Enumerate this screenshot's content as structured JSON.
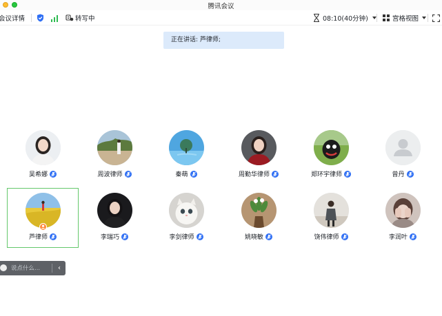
{
  "window": {
    "title": "腾讯会议"
  },
  "toolbar": {
    "meeting_details": "会议详情",
    "transcribe": "转写中",
    "time": "08:10(40分钟)",
    "view": "宫格视图"
  },
  "speaking_banner": "正在讲话: 芦律师;",
  "participants": [
    {
      "name": "吴希娜"
    },
    {
      "name": "周波律师"
    },
    {
      "name": "秦萌"
    },
    {
      "name": "周勤华律师"
    },
    {
      "name": "郑环宇律师"
    },
    {
      "name": "曾丹"
    },
    {
      "name": "芦律师"
    },
    {
      "name": "李瑞巧"
    },
    {
      "name": "李剑律师"
    },
    {
      "name": "姚晓敏"
    },
    {
      "name": "饶伟律师"
    },
    {
      "name": "李润叶"
    }
  ],
  "chat": {
    "placeholder": "说点什么..."
  },
  "colors": {
    "accent": "#2f6ff4",
    "selected_border": "#63c76a",
    "banner": "#dceafb",
    "host_badge": "#ff8a3d"
  },
  "icons": [
    "shield-icon",
    "signal-icon",
    "transcribe-icon",
    "chevron-down-icon",
    "grid-view-icon",
    "fullscreen-icon",
    "mic-icon",
    "host-icon",
    "chat-emoji-icon",
    "chevron-left-icon"
  ]
}
